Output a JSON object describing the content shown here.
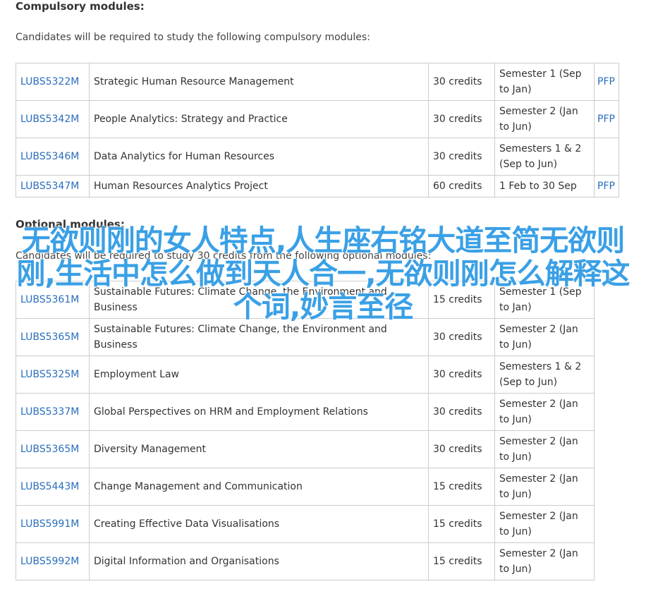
{
  "compulsory": {
    "heading": "Compulsory modules:",
    "intro": "Candidates will be required to study the following compulsory modules:",
    "rows": [
      {
        "code": "LUBS5322M",
        "title": "Strategic Human Resource Management",
        "credits": "30 credits",
        "semester": "Semester 1 (Sep to Jan)",
        "pfp": "PFP"
      },
      {
        "code": "LUBS5342M",
        "title": "People Analytics: Strategy and Practice",
        "credits": "30 credits",
        "semester": "Semester 2 (Jan to Jun)",
        "pfp": "PFP"
      },
      {
        "code": "LUBS5346M",
        "title": "Data Analytics for Human Resources",
        "credits": "30 credits",
        "semester": "Semesters 1 & 2 (Sep to Jun)",
        "pfp": ""
      },
      {
        "code": "LUBS5347M",
        "title": "Human Resources Analytics Project",
        "credits": "60 credits",
        "semester": "1 Feb to 30 Sep",
        "pfp": "PFP"
      }
    ]
  },
  "optional": {
    "heading": "Optional modules:",
    "intro": "Candidates will be required to study 30 credits from the following optional modules:",
    "rows": [
      {
        "code": "LUBS5361M",
        "title": "Sustainable Futures: Climate Change, the Environment and Business",
        "credits": "15 credits",
        "semester": "Semester 1 (Sep to Jan)"
      },
      {
        "code": "LUBS5365M",
        "title": "Sustainable Futures: Climate Change, the Environment and Business",
        "credits": "30 credits",
        "semester": "Semester 2 (Jan to Jun)"
      },
      {
        "code": "LUBS5325M",
        "title": "Employment Law",
        "credits": "30 credits",
        "semester": "Semesters 1 & 2 (Sep to Jun)"
      },
      {
        "code": "LUBS5337M",
        "title": "Global Perspectives on HRM and Employment Relations",
        "credits": "30 credits",
        "semester": "Semester 2 (Jan to Jun)"
      },
      {
        "code": "LUBS5365M",
        "title": "Diversity Management",
        "credits": "30 credits",
        "semester": "Semester 2 (Jan to Jun)"
      },
      {
        "code": "LUBS5443M",
        "title": "Change Management and Communication",
        "credits": "15 credits",
        "semester": "Semester 2 (Jan to Jun)"
      },
      {
        "code": "LUBS5991M",
        "title": "Creating Effective Data Visualisations",
        "credits": "15 credits",
        "semester": "Semester 2 (Jan to Jun)"
      },
      {
        "code": "LUBS5992M",
        "title": "Digital Information and Organisations",
        "credits": "15 credits",
        "semester": "Semester 2 (Jan to Jun)"
      }
    ]
  },
  "overlay_text": "无欲则刚的女人特点,人生座右铭大道至简无欲则刚,生活中怎么做到天人合一,无欲则刚怎么解释这个词,妙言至径",
  "colors": {
    "link": "#2a6ebb",
    "overlay": "#3aa0e6",
    "border": "#cccccc"
  }
}
